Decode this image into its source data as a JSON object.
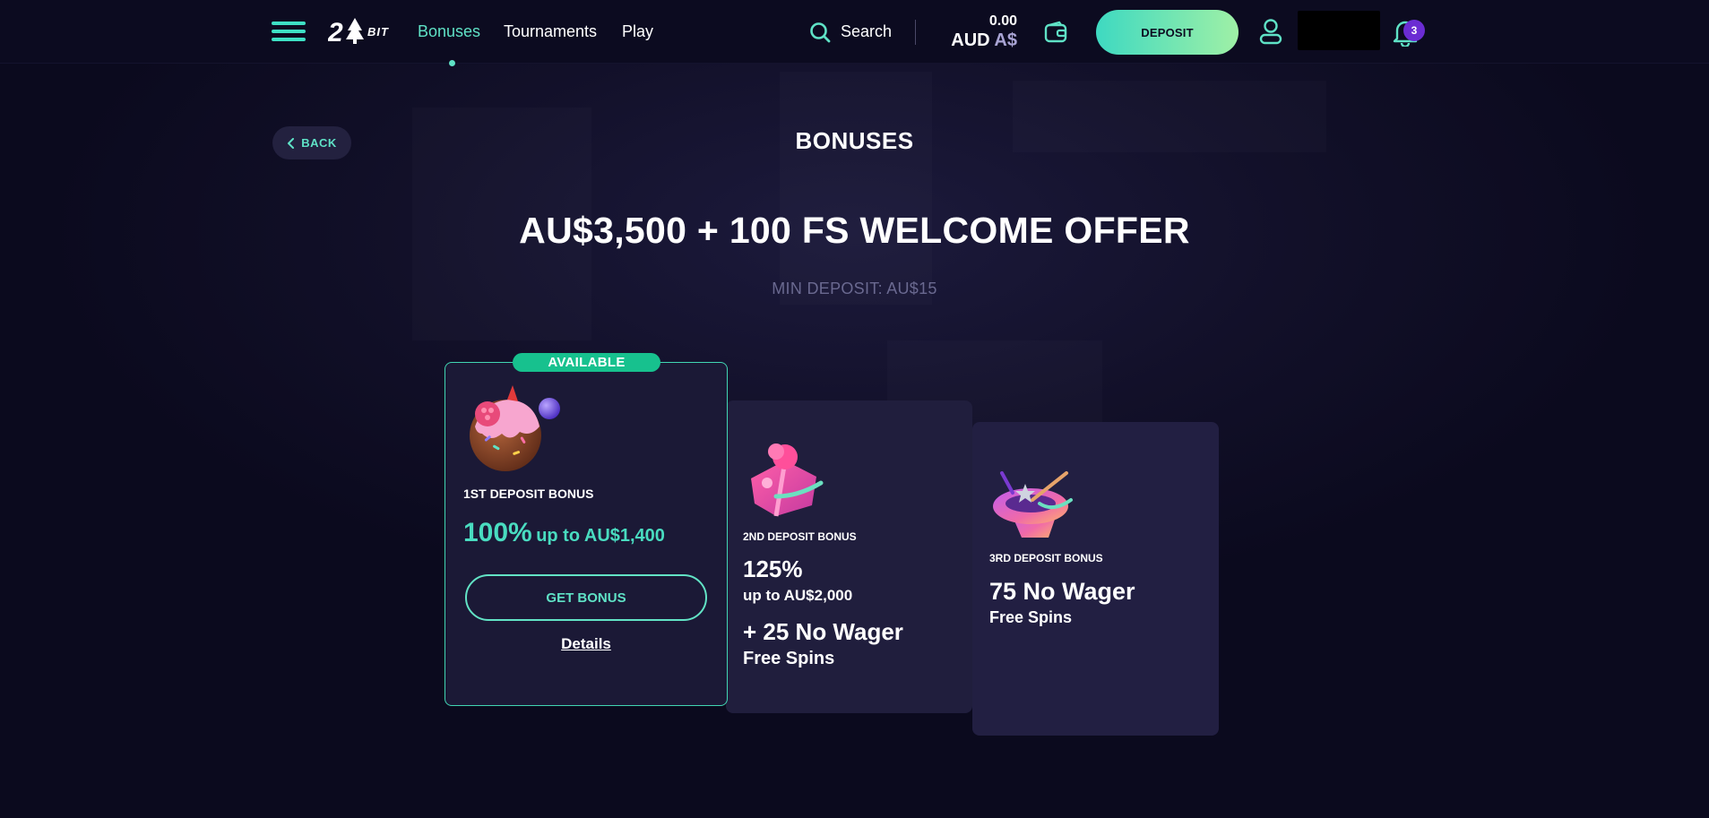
{
  "header": {
    "logo_text": "BIT",
    "nav": [
      {
        "label": "Bonuses",
        "active": true
      },
      {
        "label": "Tournaments",
        "active": false
      },
      {
        "label": "Play",
        "active": false
      }
    ],
    "search_label": "Search",
    "balance_amount": "0.00",
    "balance_currency": "AUD",
    "balance_symbol": "A$",
    "deposit_label": "DEPOSIT",
    "notification_count": "3"
  },
  "page": {
    "back_label": "BACK",
    "title": "BONUSES",
    "offer_title": "AU$3,500 + 100 FS WELCOME OFFER",
    "min_deposit": "MIN DEPOSIT: AU$15"
  },
  "cards": [
    {
      "badge": "AVAILABLE",
      "label": "1ST DEPOSIT BONUS",
      "percent": "100%",
      "upto": "up to AU$1,400",
      "button": "GET BONUS",
      "details": "Details"
    },
    {
      "label": "2ND DEPOSIT BONUS",
      "percent": "125%",
      "upto": "up to AU$2,000",
      "extra": "+ 25 No Wager",
      "extra_sub": "Free Spins"
    },
    {
      "label": "3RD DEPOSIT BONUS",
      "main": "75 No Wager",
      "sub": "Free Spins"
    }
  ],
  "colors": {
    "accent": "#5fe2c6",
    "background": "#0b0a1e",
    "card": "#1c1a38",
    "available": "#17c18e",
    "badge": "#6b2cd3"
  }
}
